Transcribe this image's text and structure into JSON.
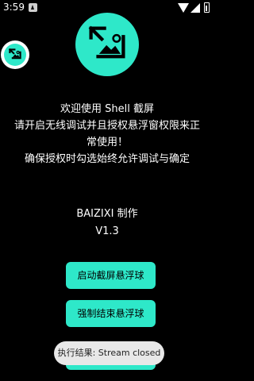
{
  "status_bar": {
    "time": "3:59",
    "icons": [
      "notification-icon",
      "wifi-icon",
      "signal-icon",
      "battery-icon"
    ]
  },
  "app": {
    "accent_color": "#2ee8c9",
    "intro_lines": [
      "欢迎使用 Shell 截屏",
      "请开启无线调试并且授权悬浮窗权限来正",
      "常使用！",
      "确保授权时勾选始终允许调试与确定"
    ],
    "credit": "BAIZIXI 制作",
    "version": "V1.3"
  },
  "buttons": {
    "start_float": "启动截屏悬浮球",
    "stop_float": "强制结束悬浮球",
    "third": ""
  },
  "toast": {
    "text": "执行结果: Stream closed"
  }
}
